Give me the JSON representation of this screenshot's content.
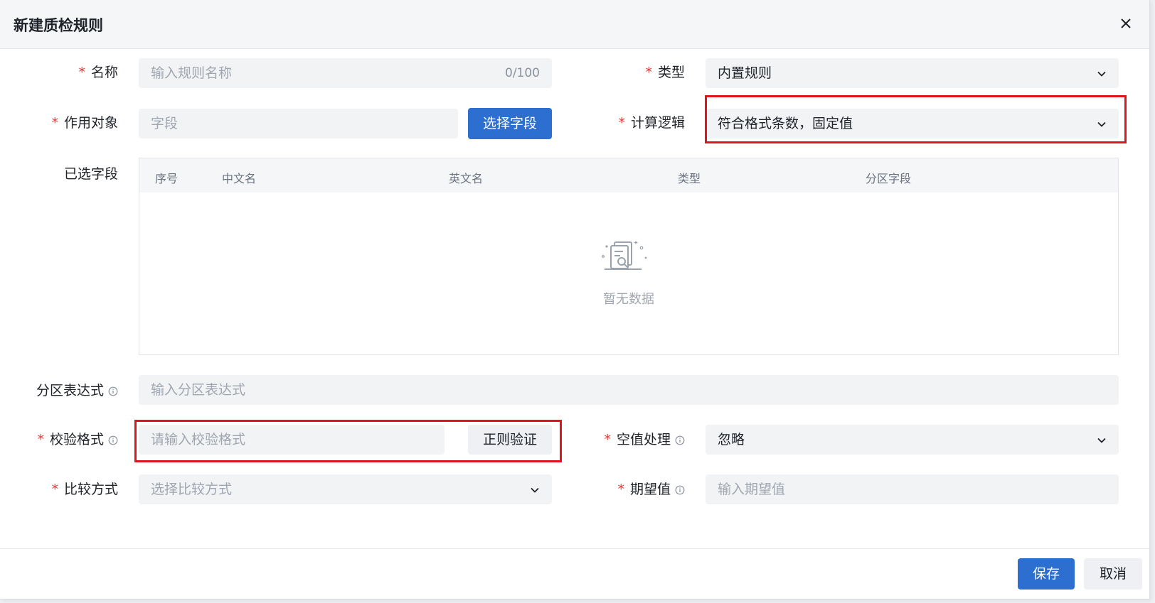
{
  "dialog": {
    "title": "新建质检规则"
  },
  "form": {
    "name": {
      "label": "名称",
      "placeholder": "输入规则名称",
      "counter": "0/100"
    },
    "type": {
      "label": "类型",
      "value": "内置规则"
    },
    "target": {
      "label": "作用对象",
      "placeholder": "字段",
      "button_label": "选择字段"
    },
    "calc_logic": {
      "label": "计算逻辑",
      "value": "符合格式条数，固定值"
    },
    "selected_fields": {
      "label": "已选字段",
      "columns": [
        "序号",
        "中文名",
        "英文名",
        "类型",
        "分区字段"
      ],
      "empty_text": "暂无数据"
    },
    "partition_expr": {
      "label": "分区表达式",
      "placeholder": "输入分区表达式"
    },
    "check_format": {
      "label": "校验格式",
      "placeholder": "请输入校验格式",
      "button_label": "正则验证"
    },
    "null_handling": {
      "label": "空值处理",
      "value": "忽略"
    },
    "compare_method": {
      "label": "比较方式",
      "placeholder": "选择比较方式"
    },
    "expected_value": {
      "label": "期望值",
      "placeholder": "输入期望值"
    }
  },
  "footer": {
    "save_label": "保存",
    "cancel_label": "取消"
  },
  "colors": {
    "primary": "#2c6fd1",
    "required": "#e53935",
    "highlight": "#e0141c"
  },
  "icons": {
    "close": "close-icon",
    "dropdown": "chevron-down-icon",
    "info": "info-circle-icon",
    "empty": "empty-document-icon"
  }
}
